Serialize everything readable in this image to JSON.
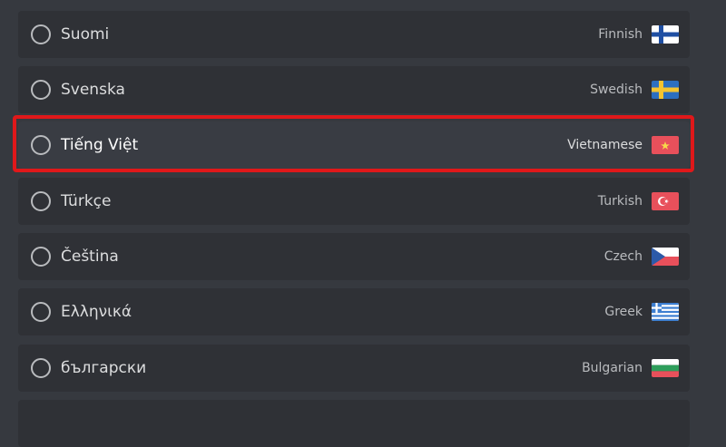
{
  "languages": [
    {
      "native": "Suomi",
      "english": "Finnish",
      "flag": "finland-flag-icon"
    },
    {
      "native": "Svenska",
      "english": "Swedish",
      "flag": "sweden-flag-icon"
    },
    {
      "native": "Tiếng Việt",
      "english": "Vietnamese",
      "flag": "vietnam-flag-icon",
      "highlighted": true
    },
    {
      "native": "Türkçe",
      "english": "Turkish",
      "flag": "turkey-flag-icon"
    },
    {
      "native": "Čeština",
      "english": "Czech",
      "flag": "czech-flag-icon"
    },
    {
      "native": "Ελληνικά",
      "english": "Greek",
      "flag": "greece-flag-icon"
    },
    {
      "native": "български",
      "english": "Bulgarian",
      "flag": "bulgaria-flag-icon"
    },
    {
      "native": "",
      "english": "",
      "flag": ""
    }
  ],
  "colors": {
    "background": "#36393f",
    "row": "#2f3136",
    "highlight_border": "#e0181a"
  }
}
